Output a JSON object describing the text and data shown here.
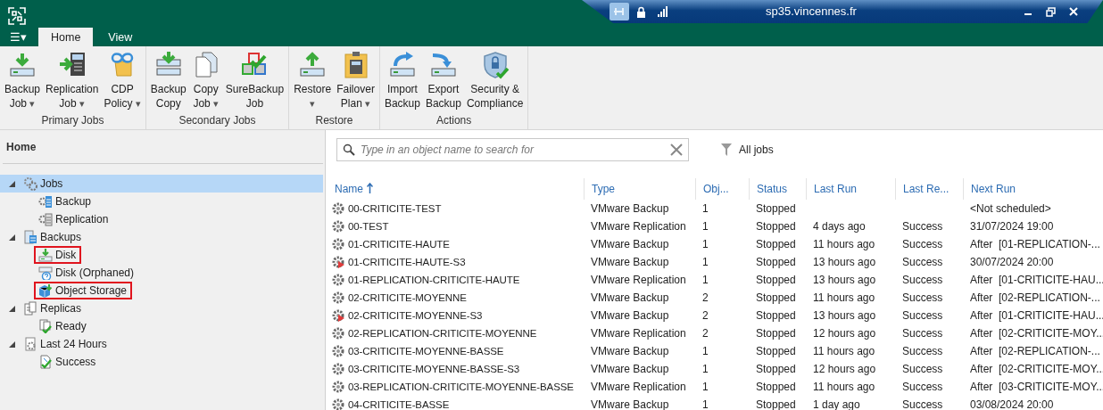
{
  "remote_bar": {
    "title": "sp35.vincennes.fr"
  },
  "menu_button": {
    "label": "☰▾"
  },
  "tabs": [
    {
      "label": "Home",
      "selected": true
    },
    {
      "label": "View",
      "selected": false
    }
  ],
  "ribbon_groups": [
    {
      "label": "Primary Jobs",
      "buttons": [
        {
          "lines": [
            "Backup",
            "Job"
          ],
          "caret": "▾"
        },
        {
          "lines": [
            "Replication",
            "Job"
          ],
          "caret": "▾"
        },
        {
          "lines": [
            "CDP",
            "Policy"
          ],
          "caret": "▾"
        }
      ]
    },
    {
      "label": "Secondary Jobs",
      "buttons": [
        {
          "lines": [
            "Backup",
            "Copy"
          ]
        },
        {
          "lines": [
            "Copy",
            "Job"
          ],
          "caret": "▾"
        },
        {
          "lines": [
            "SureBackup",
            "Job"
          ]
        }
      ]
    },
    {
      "label": "Restore",
      "buttons": [
        {
          "lines": [
            "Restore"
          ],
          "caret": "▾"
        },
        {
          "lines": [
            "Failover",
            "Plan"
          ],
          "caret": "▾"
        }
      ]
    },
    {
      "label": "Actions",
      "buttons": [
        {
          "lines": [
            "Import",
            "Backup"
          ]
        },
        {
          "lines": [
            "Export",
            "Backup"
          ]
        },
        {
          "lines": [
            "Security &",
            "Compliance"
          ]
        }
      ]
    }
  ],
  "sidebar": {
    "title": "Home",
    "tree": [
      {
        "label": "Jobs",
        "selected": true,
        "expanded": true,
        "outlined": false,
        "children": [
          {
            "label": "Backup",
            "selected": false,
            "outlined": false
          },
          {
            "label": "Replication",
            "selected": false,
            "outlined": false
          }
        ]
      },
      {
        "label": "Backups",
        "selected": false,
        "expanded": true,
        "outlined": false,
        "children": [
          {
            "label": "Disk",
            "selected": false,
            "outlined": true
          },
          {
            "label": "Disk (Orphaned)",
            "selected": false,
            "outlined": false
          },
          {
            "label": "Object Storage",
            "selected": false,
            "outlined": true
          }
        ]
      },
      {
        "label": "Replicas",
        "selected": false,
        "expanded": true,
        "outlined": false,
        "children": [
          {
            "label": "Ready",
            "selected": false,
            "outlined": false
          }
        ]
      },
      {
        "label": "Last 24 Hours",
        "selected": false,
        "expanded": true,
        "outlined": false,
        "children": [
          {
            "label": "Success",
            "selected": false,
            "outlined": false
          }
        ]
      }
    ]
  },
  "search": {
    "placeholder": "Type in an object name to search for"
  },
  "filter": {
    "label": "All jobs"
  },
  "table": {
    "columns": [
      {
        "label": "Name",
        "sorted": true
      },
      {
        "label": "Type",
        "sorted": false
      },
      {
        "label": "Obj...",
        "sorted": false
      },
      {
        "label": "Status",
        "sorted": false
      },
      {
        "label": "Last Run",
        "sorted": false
      },
      {
        "label": "Last Re...",
        "sorted": false
      },
      {
        "label": "Next Run",
        "sorted": false
      }
    ],
    "rows": [
      {
        "kind": "job",
        "cells": [
          "00-CRITICITE-TEST",
          "VMware Backup",
          "1",
          "Stopped",
          "",
          "",
          "<Not scheduled>"
        ]
      },
      {
        "kind": "job",
        "cells": [
          "00-TEST",
          "VMware Replication",
          "1",
          "Stopped",
          "4 days ago",
          "Success",
          "31/07/2024 19:00"
        ]
      },
      {
        "kind": "job",
        "cells": [
          "01-CRITICITE-HAUTE",
          "VMware Backup",
          "1",
          "Stopped",
          "11 hours ago",
          "Success",
          "After  [01-REPLICATION-..."
        ]
      },
      {
        "kind": "flagged-job",
        "cells": [
          "01-CRITICITE-HAUTE-S3",
          "VMware Backup",
          "1",
          "Stopped",
          "13 hours ago",
          "Success",
          "30/07/2024 20:00"
        ]
      },
      {
        "kind": "job",
        "cells": [
          "01-REPLICATION-CRITICITE-HAUTE",
          "VMware Replication",
          "1",
          "Stopped",
          "13 hours ago",
          "Success",
          "After  [01-CRITICITE-HAU..."
        ]
      },
      {
        "kind": "job",
        "cells": [
          "02-CRITICITE-MOYENNE",
          "VMware Backup",
          "2",
          "Stopped",
          "11 hours ago",
          "Success",
          "After  [02-REPLICATION-..."
        ]
      },
      {
        "kind": "flagged-job",
        "cells": [
          "02-CRITICITE-MOYENNE-S3",
          "VMware Backup",
          "2",
          "Stopped",
          "13 hours ago",
          "Success",
          "After  [01-CRITICITE-HAU..."
        ]
      },
      {
        "kind": "job",
        "cells": [
          "02-REPLICATION-CRITICITE-MOYENNE",
          "VMware Replication",
          "2",
          "Stopped",
          "12 hours ago",
          "Success",
          "After  [02-CRITICITE-MOY..."
        ]
      },
      {
        "kind": "job",
        "cells": [
          "03-CRITICITE-MOYENNE-BASSE",
          "VMware Backup",
          "1",
          "Stopped",
          "11 hours ago",
          "Success",
          "After  [02-REPLICATION-..."
        ]
      },
      {
        "kind": "job",
        "cells": [
          "03-CRITICITE-MOYENNE-BASSE-S3",
          "VMware Backup",
          "1",
          "Stopped",
          "12 hours ago",
          "Success",
          "After  [02-CRITICITE-MOY..."
        ]
      },
      {
        "kind": "job",
        "cells": [
          "03-REPLICATION-CRITICITE-MOYENNE-BASSE",
          "VMware Replication",
          "1",
          "Stopped",
          "11 hours ago",
          "Success",
          "After  [03-CRITICITE-MOY..."
        ]
      },
      {
        "kind": "job",
        "cells": [
          "04-CRITICITE-BASSE",
          "VMware Backup",
          "1",
          "Stopped",
          "1 day ago",
          "Success",
          "03/08/2024 20:00"
        ]
      }
    ]
  }
}
